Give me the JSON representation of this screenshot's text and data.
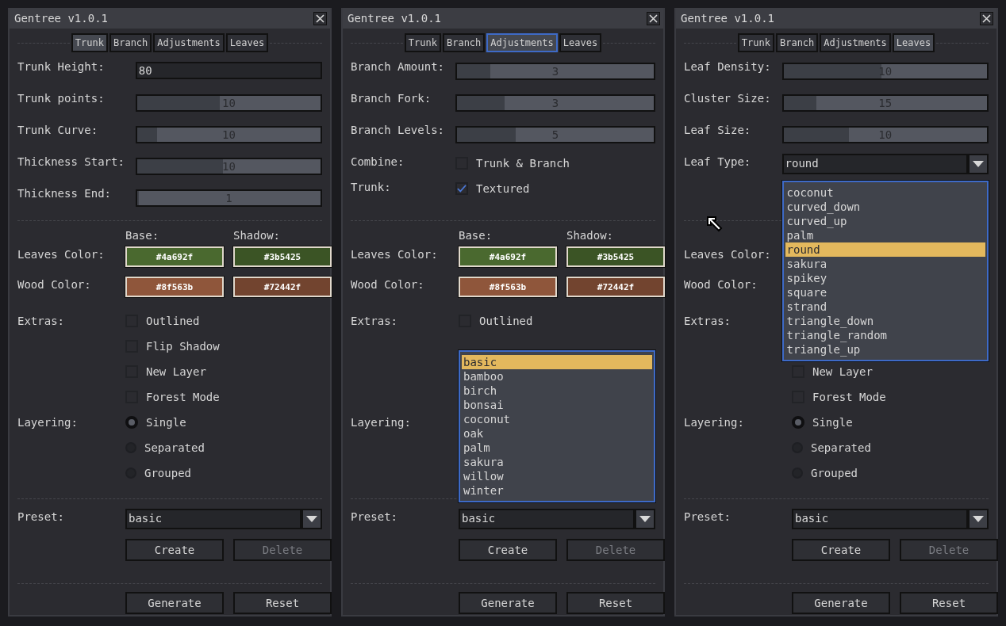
{
  "panels": [
    {
      "title": "Gentree v1.0.1",
      "tabs": [
        {
          "label": "Trunk",
          "selected": true,
          "focused": false
        },
        {
          "label": "Branch",
          "selected": false,
          "focused": false
        },
        {
          "label": "Adjustments",
          "selected": false,
          "focused": false
        },
        {
          "label": "Leaves",
          "selected": false,
          "focused": false
        }
      ],
      "fields": [
        {
          "kind": "input",
          "label": "Trunk Height:",
          "value": "80"
        },
        {
          "kind": "slider",
          "label": "Trunk points:",
          "value": "10",
          "level": 0.45
        },
        {
          "kind": "slider",
          "label": "Trunk Curve:",
          "value": "10",
          "level": 0.11
        },
        {
          "kind": "slider",
          "label": "Thickness Start:",
          "value": "10",
          "level": 0.47
        },
        {
          "kind": "slider",
          "label": "Thickness End:",
          "value": "1",
          "level": 0
        }
      ],
      "colors": {
        "headers": [
          "Base:",
          "Shadow:"
        ],
        "rows": [
          {
            "label": "Leaves Color:",
            "swatches": [
              {
                "text": "#4a692f",
                "color": "#4a692f"
              },
              {
                "text": "#3b5425",
                "color": "#3b5425"
              }
            ]
          },
          {
            "label": "Wood Color:",
            "swatches": [
              {
                "text": "#8f563b",
                "color": "#8f563b"
              },
              {
                "text": "#72442f",
                "color": "#72442f"
              }
            ]
          }
        ]
      },
      "extras": {
        "label": "Extras:",
        "options": [
          {
            "label": "Outlined",
            "checked": false
          },
          {
            "label": "Flip Shadow",
            "checked": false
          },
          {
            "label": "New Layer",
            "checked": false
          },
          {
            "label": "Forest Mode",
            "checked": false
          }
        ]
      },
      "layering": {
        "label": "Layering:",
        "options": [
          {
            "label": "Single",
            "selected": true
          },
          {
            "label": "Separated",
            "selected": false
          },
          {
            "label": "Grouped",
            "selected": false
          }
        ]
      },
      "preset": {
        "label": "Preset:",
        "value": "basic",
        "expanded": false
      },
      "preset_buttons": [
        {
          "label": "Create",
          "disabled": false
        },
        {
          "label": "Delete",
          "disabled": true
        }
      ],
      "actions": [
        {
          "label": "Generate"
        },
        {
          "label": "Reset"
        }
      ]
    },
    {
      "title": "Gentree v1.0.1",
      "tabs": [
        {
          "label": "Trunk",
          "selected": false,
          "focused": false
        },
        {
          "label": "Branch",
          "selected": false,
          "focused": false
        },
        {
          "label": "Adjustments",
          "selected": true,
          "focused": true
        },
        {
          "label": "Leaves",
          "selected": false,
          "focused": false
        }
      ],
      "fields": [
        {
          "kind": "slider",
          "label": "Branch Amount:",
          "value": "3",
          "level": 0.17
        },
        {
          "kind": "slider",
          "label": "Branch Fork:",
          "value": "3",
          "level": 0.24
        },
        {
          "kind": "slider",
          "label": "Branch Levels:",
          "value": "5",
          "level": 0.3
        },
        {
          "kind": "checkbox",
          "label": "Combine:",
          "option": "Trunk & Branch",
          "checked": false
        },
        {
          "kind": "checkbox",
          "label": "Trunk:",
          "option": "Textured",
          "checked": true
        }
      ],
      "colors": {
        "headers": [
          "Base:",
          "Shadow:"
        ],
        "rows": [
          {
            "label": "Leaves Color:",
            "swatches": [
              {
                "text": "#4a692f",
                "color": "#4a692f"
              },
              {
                "text": "#3b5425",
                "color": "#3b5425"
              }
            ]
          },
          {
            "label": "Wood Color:",
            "swatches": [
              {
                "text": "#8f563b",
                "color": "#8f563b"
              },
              {
                "text": "#72442f",
                "color": "#72442f"
              }
            ]
          }
        ]
      },
      "extras": {
        "label": "Extras:",
        "options": [
          {
            "label": "Outlined",
            "checked": false
          }
        ]
      },
      "layering": {
        "label": "Layering:"
      },
      "preset": {
        "label": "Preset:",
        "value": "basic",
        "expanded": true,
        "options": [
          {
            "label": "basic",
            "selected": true
          },
          {
            "label": "bamboo",
            "selected": false
          },
          {
            "label": "birch",
            "selected": false
          },
          {
            "label": "bonsai",
            "selected": false
          },
          {
            "label": "coconut",
            "selected": false
          },
          {
            "label": "oak",
            "selected": false
          },
          {
            "label": "palm",
            "selected": false
          },
          {
            "label": "sakura",
            "selected": false
          },
          {
            "label": "willow",
            "selected": false
          },
          {
            "label": "winter",
            "selected": false
          }
        ]
      },
      "preset_buttons": [
        {
          "label": "Create",
          "disabled": false
        },
        {
          "label": "Delete",
          "disabled": true
        }
      ],
      "actions": [
        {
          "label": "Generate"
        },
        {
          "label": "Reset"
        }
      ]
    },
    {
      "title": "Gentree v1.0.1",
      "pointer": true,
      "tabs": [
        {
          "label": "Trunk",
          "selected": false,
          "focused": false
        },
        {
          "label": "Branch",
          "selected": false,
          "focused": false
        },
        {
          "label": "Adjustments",
          "selected": false,
          "focused": false
        },
        {
          "label": "Leaves",
          "selected": true,
          "focused": false
        }
      ],
      "fields": [
        {
          "kind": "slider",
          "label": "Leaf Density:",
          "value": "10",
          "level": 0.48
        },
        {
          "kind": "slider",
          "label": "Cluster Size:",
          "value": "15",
          "level": 0.16
        },
        {
          "kind": "slider",
          "label": "Leaf Size:",
          "value": "10",
          "level": 0.32
        },
        {
          "kind": "dropdown",
          "label": "Leaf Type:",
          "value": "round",
          "expanded": true,
          "options": [
            {
              "label": "coconut",
              "selected": false
            },
            {
              "label": "curved_down",
              "selected": false
            },
            {
              "label": "curved_up",
              "selected": false
            },
            {
              "label": "palm",
              "selected": false
            },
            {
              "label": "round",
              "selected": true
            },
            {
              "label": "sakura",
              "selected": false
            },
            {
              "label": "spikey",
              "selected": false
            },
            {
              "label": "square",
              "selected": false
            },
            {
              "label": "strand",
              "selected": false
            },
            {
              "label": "triangle_down",
              "selected": false
            },
            {
              "label": "triangle_random",
              "selected": false
            },
            {
              "label": "triangle_up",
              "selected": false
            }
          ]
        }
      ],
      "colors": {
        "rows": [
          {
            "label": "Leaves Color:"
          },
          {
            "label": "Wood Color:"
          }
        ]
      },
      "extras": {
        "label": "Extras:",
        "options": [
          {
            "label": "New Layer",
            "checked": false
          },
          {
            "label": "Forest Mode",
            "checked": false
          }
        ]
      },
      "layering": {
        "label": "Layering:",
        "options": [
          {
            "label": "Single",
            "selected": true
          },
          {
            "label": "Separated",
            "selected": false
          },
          {
            "label": "Grouped",
            "selected": false
          }
        ]
      },
      "preset": {
        "label": "Preset:",
        "value": "basic",
        "expanded": false
      },
      "preset_buttons": [
        {
          "label": "Create",
          "disabled": false
        },
        {
          "label": "Delete",
          "disabled": true
        }
      ],
      "actions": [
        {
          "label": "Generate"
        },
        {
          "label": "Reset"
        }
      ]
    }
  ]
}
